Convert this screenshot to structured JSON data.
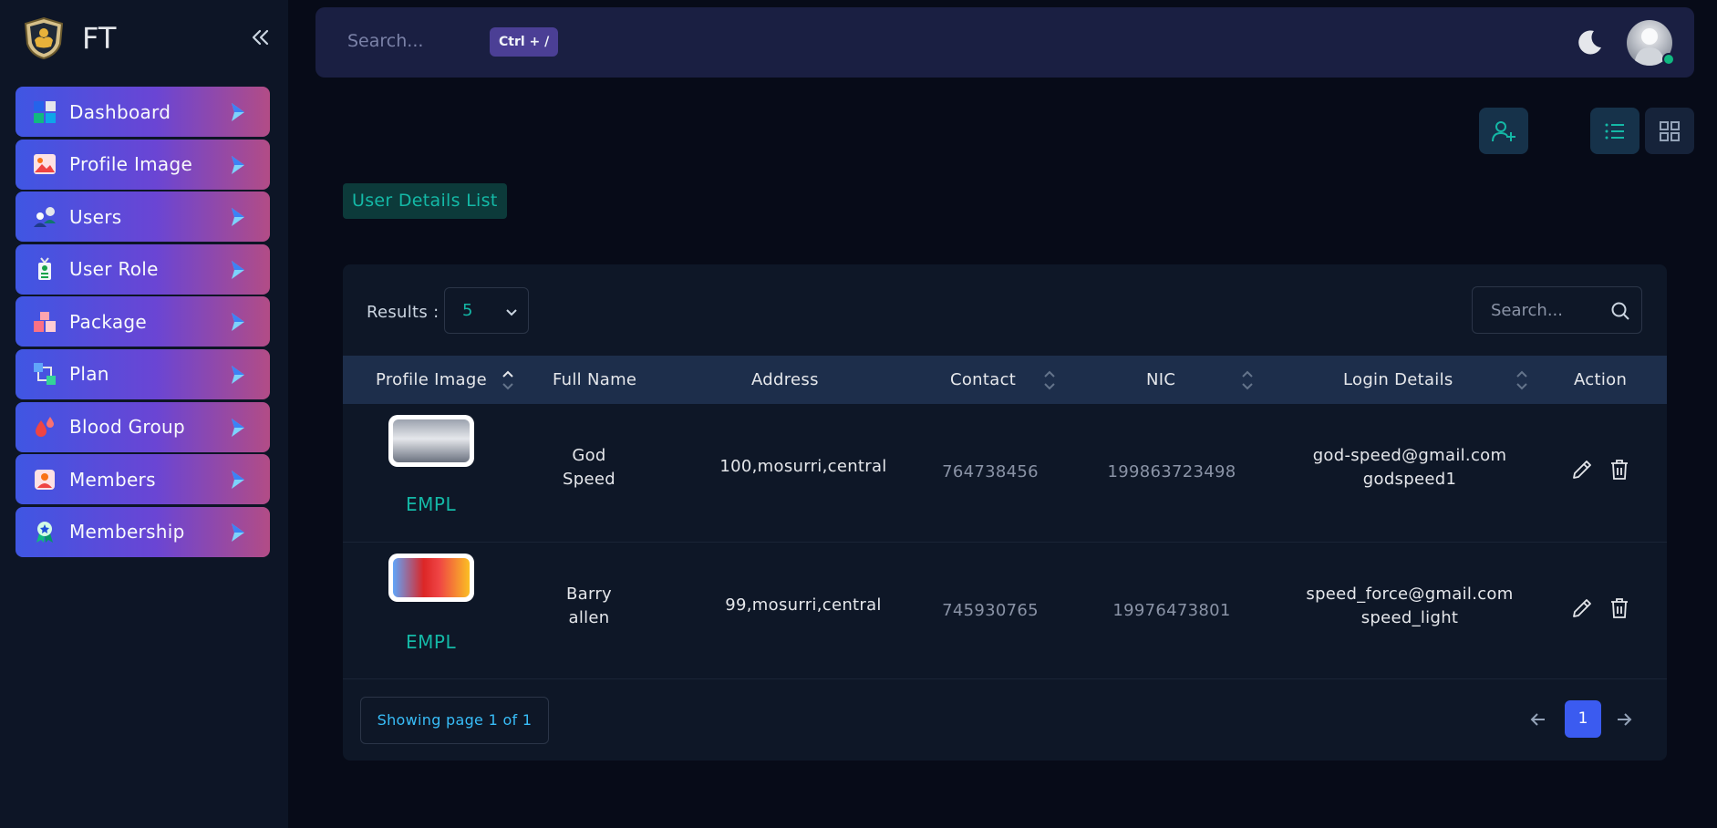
{
  "app": {
    "brand": "FT"
  },
  "sidebar": {
    "items": [
      {
        "label": "Dashboard",
        "icon": "dashboard-icon"
      },
      {
        "label": "Profile Image",
        "icon": "image-icon"
      },
      {
        "label": "Users",
        "icon": "users-icon"
      },
      {
        "label": "User Role",
        "icon": "id-badge-icon"
      },
      {
        "label": "Package",
        "icon": "package-icon"
      },
      {
        "label": "Plan",
        "icon": "plan-icon"
      },
      {
        "label": "Blood Group",
        "icon": "blood-drop-icon"
      },
      {
        "label": "Members",
        "icon": "member-icon"
      },
      {
        "label": "Membership",
        "icon": "award-icon"
      }
    ]
  },
  "topbar": {
    "search_placeholder": "Search...",
    "shortcut": "Ctrl + /"
  },
  "page": {
    "title": "User Details List"
  },
  "table": {
    "results_label": "Results :",
    "results_value": "5",
    "search_placeholder": "Search...",
    "columns": [
      "Profile Image",
      "Full Name",
      "Address",
      "Contact",
      "NIC",
      "Login Details",
      "Action"
    ],
    "rows": [
      {
        "role": "EMPL",
        "name_line1": "God",
        "name_line2": "Speed",
        "address": "100,mosurri,central",
        "contact": "764738456",
        "nic": "199863723498",
        "email": "god-speed@gmail.com",
        "username": "godspeed1"
      },
      {
        "role": "EMPL",
        "name_line1": "Barry",
        "name_line2": "allen",
        "address": "99,mosurri,central",
        "contact": "745930765",
        "nic": "19976473801",
        "email": "speed_force@gmail.com",
        "username": "speed_light"
      }
    ],
    "page_info": "Showing page 1 of 1",
    "current_page": "1"
  },
  "colors": {
    "accent": "#14b8a6",
    "primary": "#3b5bf0",
    "nav_gradient_start": "#3f56e3",
    "nav_gradient_end": "#b24c86"
  }
}
